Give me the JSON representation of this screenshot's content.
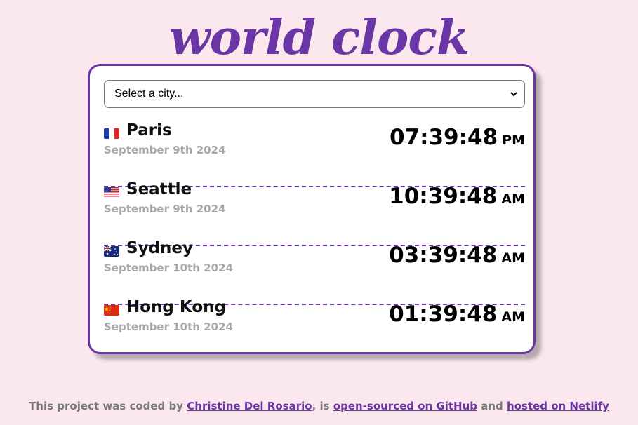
{
  "title": "world clock",
  "select": {
    "selected": "Select a city..."
  },
  "cities": [
    {
      "name": "Paris",
      "date": "September 9th 2024",
      "time": "07:39:48",
      "ampm": "PM",
      "flag": "flag-france-icon"
    },
    {
      "name": "Seattle",
      "date": "September 9th 2024",
      "time": "10:39:48",
      "ampm": "AM",
      "flag": "flag-usa-icon"
    },
    {
      "name": "Sydney",
      "date": "September 10th 2024",
      "time": "03:39:48",
      "ampm": "AM",
      "flag": "flag-australia-icon"
    },
    {
      "name": "Hong Kong",
      "date": "September 10th 2024",
      "time": "01:39:48",
      "ampm": "AM",
      "flag": "flag-china-icon"
    }
  ],
  "footer": {
    "prefix": "This project was coded by ",
    "author_link": "Christine Del Rosario",
    "middle": ", is ",
    "github_link": "open-sourced on GitHub",
    "and": " and ",
    "netlify_link": "hosted on Netlify"
  },
  "colors": {
    "accent": "#6a36a6",
    "background": "#fbe8ee",
    "date_gray": "#a7a7a7"
  }
}
